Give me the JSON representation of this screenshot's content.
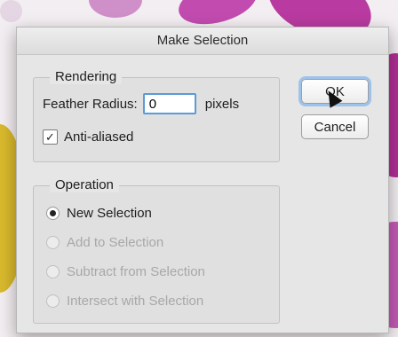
{
  "dialog": {
    "title": "Make Selection",
    "rendering": {
      "legend": "Rendering",
      "feather_label": "Feather Radius:",
      "feather_value": "0",
      "feather_unit": "pixels",
      "anti_aliased_label": "Anti-aliased",
      "anti_aliased_checked": true
    },
    "operation": {
      "legend": "Operation",
      "options": [
        {
          "label": "New Selection",
          "selected": true,
          "enabled": true
        },
        {
          "label": "Add to Selection",
          "selected": false,
          "enabled": false
        },
        {
          "label": "Subtract from Selection",
          "selected": false,
          "enabled": false
        },
        {
          "label": "Intersect with Selection",
          "selected": false,
          "enabled": false
        }
      ]
    },
    "buttons": {
      "ok": "OK",
      "cancel": "Cancel"
    }
  }
}
